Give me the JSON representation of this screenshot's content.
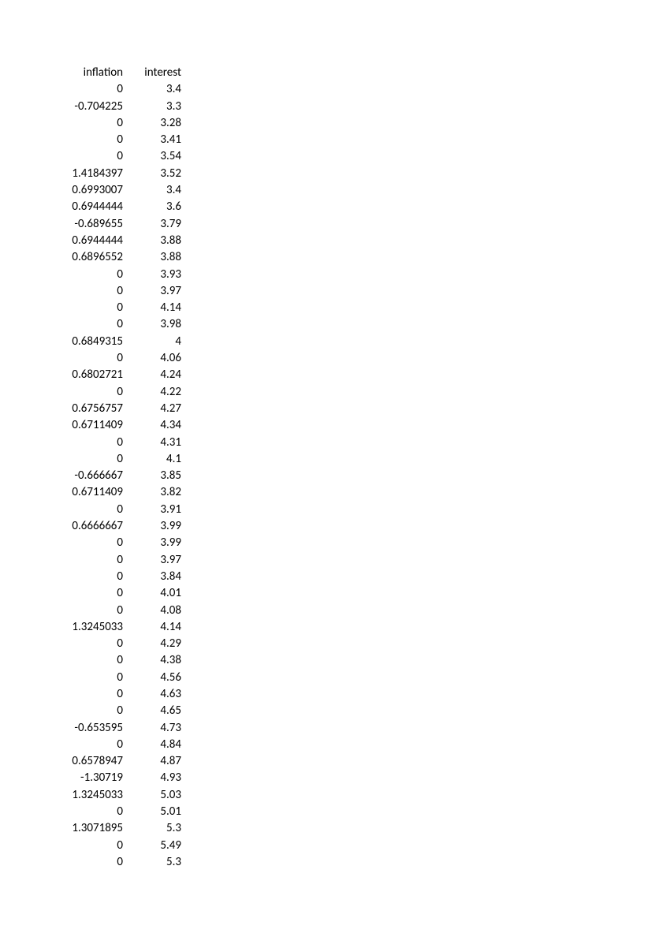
{
  "table": {
    "headers": [
      "inflation",
      "interest"
    ],
    "rows": [
      [
        "0",
        "3.4"
      ],
      [
        "-0.704225",
        "3.3"
      ],
      [
        "0",
        "3.28"
      ],
      [
        "0",
        "3.41"
      ],
      [
        "0",
        "3.54"
      ],
      [
        "1.4184397",
        "3.52"
      ],
      [
        "0.6993007",
        "3.4"
      ],
      [
        "0.6944444",
        "3.6"
      ],
      [
        "-0.689655",
        "3.79"
      ],
      [
        "0.6944444",
        "3.88"
      ],
      [
        "0.6896552",
        "3.88"
      ],
      [
        "0",
        "3.93"
      ],
      [
        "0",
        "3.97"
      ],
      [
        "0",
        "4.14"
      ],
      [
        "0",
        "3.98"
      ],
      [
        "0.6849315",
        "4"
      ],
      [
        "0",
        "4.06"
      ],
      [
        "0.6802721",
        "4.24"
      ],
      [
        "0",
        "4.22"
      ],
      [
        "0.6756757",
        "4.27"
      ],
      [
        "0.6711409",
        "4.34"
      ],
      [
        "0",
        "4.31"
      ],
      [
        "0",
        "4.1"
      ],
      [
        "-0.666667",
        "3.85"
      ],
      [
        "0.6711409",
        "3.82"
      ],
      [
        "0",
        "3.91"
      ],
      [
        "0.6666667",
        "3.99"
      ],
      [
        "0",
        "3.99"
      ],
      [
        "0",
        "3.97"
      ],
      [
        "0",
        "3.84"
      ],
      [
        "0",
        "4.01"
      ],
      [
        "0",
        "4.08"
      ],
      [
        "1.3245033",
        "4.14"
      ],
      [
        "0",
        "4.29"
      ],
      [
        "0",
        "4.38"
      ],
      [
        "0",
        "4.56"
      ],
      [
        "0",
        "4.63"
      ],
      [
        "0",
        "4.65"
      ],
      [
        "-0.653595",
        "4.73"
      ],
      [
        "0",
        "4.84"
      ],
      [
        "0.6578947",
        "4.87"
      ],
      [
        "-1.30719",
        "4.93"
      ],
      [
        "1.3245033",
        "5.03"
      ],
      [
        "0",
        "5.01"
      ],
      [
        "1.3071895",
        "5.3"
      ],
      [
        "0",
        "5.49"
      ],
      [
        "0",
        "5.3"
      ]
    ]
  }
}
